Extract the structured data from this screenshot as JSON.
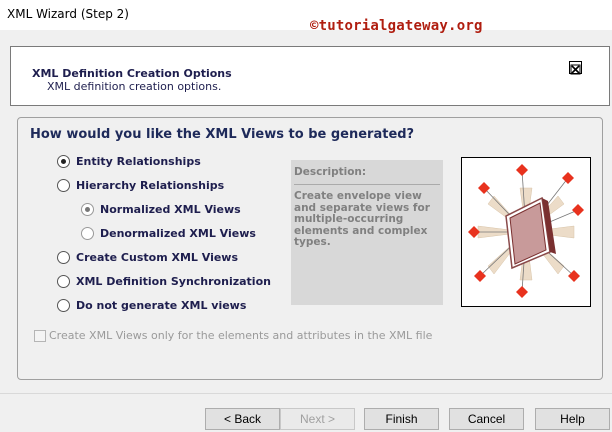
{
  "window": {
    "title": "XML Wizard (Step 2)"
  },
  "watermark": "©tutorialgateway.org",
  "header": {
    "title": "XML Definition Creation Options",
    "subtitle": "XML definition creation options."
  },
  "question": "How would you like the XML Views to be generated?",
  "options": [
    {
      "label": "Entity Relationships",
      "selected": true
    },
    {
      "label": "Hierarchy Relationships",
      "selected": false
    },
    {
      "label": "Normalized XML Views",
      "selected": true
    },
    {
      "label": "Denormalized XML Views",
      "selected": false
    },
    {
      "label": "Create Custom XML Views",
      "selected": false
    },
    {
      "label": "XML Definition Synchronization",
      "selected": false
    },
    {
      "label": "Do not generate XML views",
      "selected": false
    }
  ],
  "description": {
    "title": "Description:",
    "text": "Create envelope view and separate views for multiple-occurring elements and complex types."
  },
  "checkbox": {
    "label": "Create XML Views only for the elements and attributes in the XML file",
    "checked": false,
    "enabled": false
  },
  "buttons": {
    "back": "< Back",
    "next": "Next >",
    "finish": "Finish",
    "cancel": "Cancel",
    "help": "Help"
  },
  "colors": {
    "watermark": "#b01e10",
    "heading": "#1e2a5a",
    "diamond": "#e8321e"
  },
  "icons": {
    "header_close": "close-box-icon",
    "illustration": "document-network-icon"
  }
}
